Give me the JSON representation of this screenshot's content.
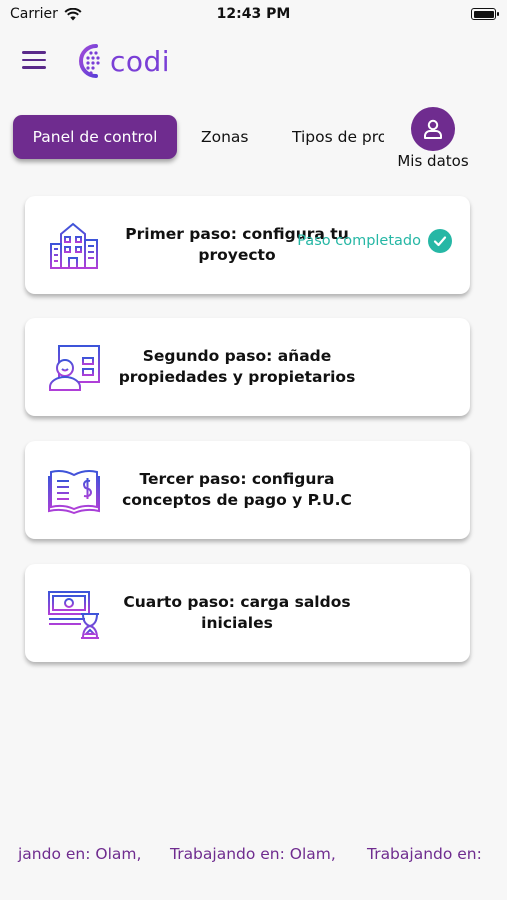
{
  "status_bar": {
    "carrier": "Carrier",
    "time": "12:43 PM"
  },
  "header": {
    "logo_text": "codi"
  },
  "tabs": [
    {
      "label": "Panel de control",
      "active": true
    },
    {
      "label": "Zonas",
      "active": false
    },
    {
      "label": "Tipos de pro",
      "active": false
    }
  ],
  "my_data": {
    "label": "Mis datos"
  },
  "steps": [
    {
      "title": "Primer paso: configura tu proyecto",
      "status": "Paso completado",
      "icon": "building-icon"
    },
    {
      "title": "Segundo paso: añade propiedades y propietarios",
      "icon": "owner-property-icon"
    },
    {
      "title": "Tercer paso: configura conceptos de pago y P.U.C",
      "icon": "payment-book-icon"
    },
    {
      "title": "Cuarto paso: carga saldos iniciales",
      "icon": "money-hourglass-icon"
    }
  ],
  "footer": {
    "items": [
      "jando en: Olam,",
      "Trabajando en: Olam,",
      "Trabajando en:"
    ]
  },
  "colors": {
    "primary": "#6f2c8f",
    "logo": "#7a3fd6",
    "success": "#26b7a5"
  }
}
